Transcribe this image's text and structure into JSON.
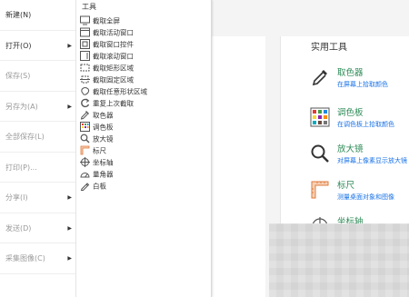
{
  "file_menu": {
    "items": [
      {
        "label": "新建(N)",
        "enabled": true,
        "submenu": false
      },
      {
        "label": "打开(O)",
        "enabled": true,
        "submenu": true
      },
      {
        "label": "保存(S)",
        "enabled": false,
        "submenu": false
      },
      {
        "label": "另存为(A)",
        "enabled": false,
        "submenu": true
      },
      {
        "label": "全部保存(L)",
        "enabled": false,
        "submenu": false
      },
      {
        "label": "打印(P)...",
        "enabled": false,
        "submenu": false
      },
      {
        "label": "分享(I)",
        "enabled": false,
        "submenu": true
      },
      {
        "label": "发送(D)",
        "enabled": false,
        "submenu": true
      },
      {
        "label": "采集图像(C)",
        "enabled": false,
        "submenu": true
      }
    ],
    "arrow_glyph": "▶"
  },
  "tools_menu": {
    "title": "工具",
    "items": [
      {
        "label": "截取全屏",
        "icon": "fullscreen-capture-icon"
      },
      {
        "label": "截取活动窗口",
        "icon": "window-capture-icon"
      },
      {
        "label": "截取窗口控件",
        "icon": "control-capture-icon"
      },
      {
        "label": "截取滚动窗口",
        "icon": "scroll-capture-icon"
      },
      {
        "label": "截取矩形区域",
        "icon": "rect-capture-icon"
      },
      {
        "label": "截取固定区域",
        "icon": "fixed-region-icon"
      },
      {
        "label": "截取任意形状区域",
        "icon": "freeform-capture-icon"
      },
      {
        "label": "重复上次截取",
        "icon": "repeat-capture-icon"
      },
      {
        "label": "取色器",
        "icon": "eyedropper-icon"
      },
      {
        "label": "调色板",
        "icon": "palette-icon"
      },
      {
        "label": "放大镜",
        "icon": "magnifier-icon"
      },
      {
        "label": "标尺",
        "icon": "ruler-icon"
      },
      {
        "label": "坐标轴",
        "icon": "axis-icon"
      },
      {
        "label": "量角器",
        "icon": "protractor-icon"
      },
      {
        "label": "白板",
        "icon": "whiteboard-icon"
      }
    ]
  },
  "utilities_panel": {
    "title": "实用工具",
    "items": [
      {
        "name": "取色器",
        "desc": "在屏幕上拾取颜色",
        "icon": "eyedropper-icon"
      },
      {
        "name": "调色板",
        "desc": "在调色板上拾取颜色",
        "icon": "palette-icon"
      },
      {
        "name": "放大镜",
        "desc": "对屏幕上像素显示放大镜",
        "icon": "magnifier-icon"
      },
      {
        "name": "标尺",
        "desc": "测量桌面对象和图像",
        "icon": "ruler-icon"
      },
      {
        "name": "坐标轴",
        "desc": "",
        "icon": "axis-icon"
      }
    ]
  },
  "colors": {
    "link": "#1a73e8",
    "tool_name": "#2e8b57",
    "disabled_text": "#9a9a9a"
  }
}
